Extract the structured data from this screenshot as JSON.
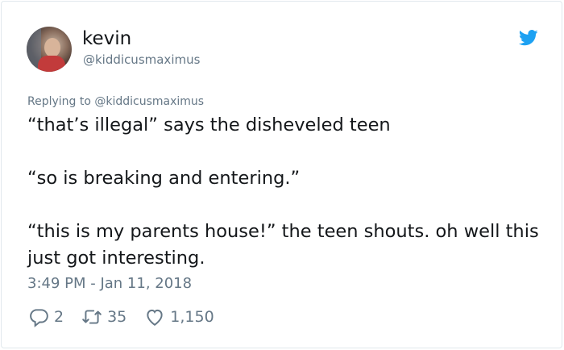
{
  "author": {
    "name": "kevin",
    "handle": "@kiddicusmaximus"
  },
  "reply_context": "Replying to @kiddicusmaximus",
  "tweet": {
    "text": "“that’s illegal” says the disheveled teen\n\n“so is breaking and entering.”\n\n“this is my parents house!” the teen shouts. oh well this just got interesting.",
    "timestamp": "3:49 PM - Jan 11, 2018"
  },
  "stats": {
    "replies": "2",
    "retweets": "35",
    "likes": "1,150"
  },
  "colors": {
    "text": "#14171a",
    "muted": "#657786",
    "brand": "#1da1f2",
    "border": "#e1e8ed"
  },
  "icons": [
    "avatar",
    "twitter-bird-icon",
    "reply-icon",
    "retweet-icon",
    "like-icon"
  ]
}
